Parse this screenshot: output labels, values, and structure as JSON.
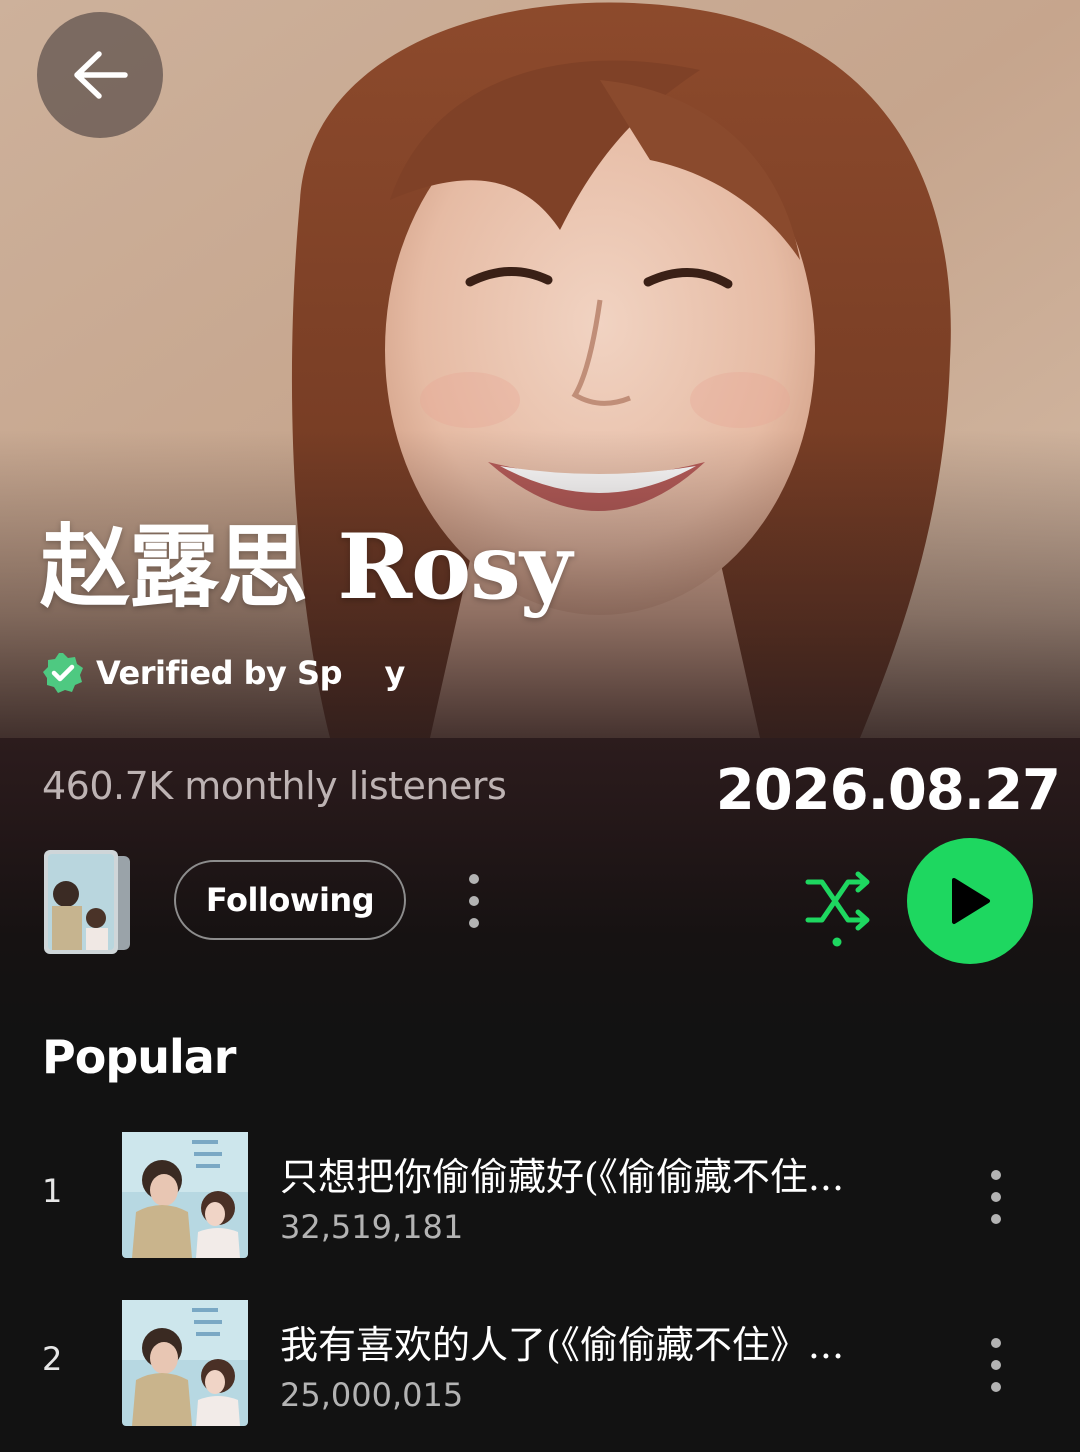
{
  "artist": {
    "name": "赵露思 Rosy",
    "verified_label": "Verified by Sp    y",
    "monthly_listeners": "460.7K monthly listeners"
  },
  "overlay": {
    "date": "2026.08.27"
  },
  "actions": {
    "follow_label": "Following",
    "more_icon": "more-vertical-icon",
    "shuffle_icon": "shuffle-icon",
    "play_icon": "play-icon",
    "back_icon": "arrow-left-icon"
  },
  "popular": {
    "title": "Popular",
    "tracks": [
      {
        "rank": "1",
        "title": "只想把你偷偷藏好(《偷偷藏不住...",
        "plays": "32,519,181"
      },
      {
        "rank": "2",
        "title": "我有喜欢的人了(《偷偷藏不住》...",
        "plays": "25,000,015"
      }
    ]
  },
  "colors": {
    "accent": "#1ed760",
    "background": "#121212",
    "band_top": "#2c1c1d",
    "secondary_text": "#b3b3b3"
  }
}
